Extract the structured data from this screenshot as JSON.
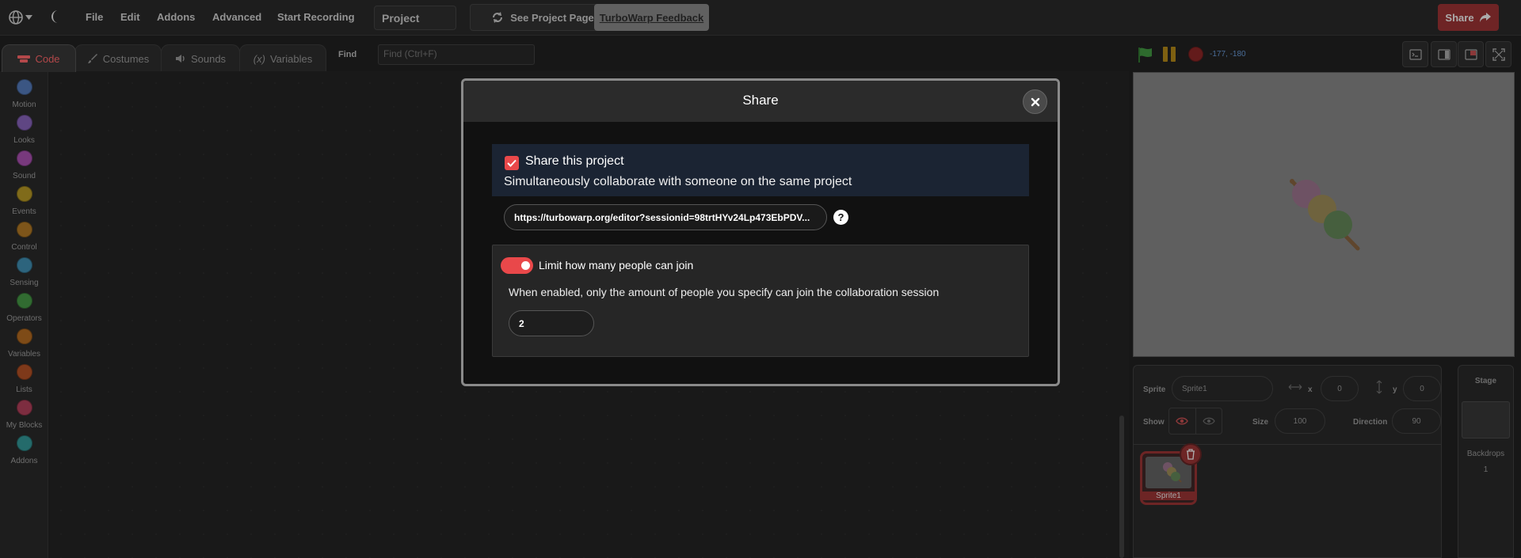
{
  "menubar": {
    "file": "File",
    "edit": "Edit",
    "addons": "Addons",
    "advanced": "Advanced",
    "start_recording": "Start Recording",
    "project_title": "Project",
    "see_project_page": "See Project Page",
    "feedback": "TurboWarp Feedback",
    "share": "Share"
  },
  "tabs": [
    {
      "label": "Code",
      "active": true
    },
    {
      "label": "Costumes"
    },
    {
      "label": "Sounds"
    },
    {
      "label": "Variables"
    }
  ],
  "find": {
    "label": "Find",
    "placeholder": "Find (Ctrl+F)"
  },
  "categories": [
    {
      "label": "Motion",
      "color": "#4c6fa8"
    },
    {
      "label": "Looks",
      "color": "#7a5aa8"
    },
    {
      "label": "Sound",
      "color": "#9a4aa0"
    },
    {
      "label": "Events",
      "color": "#a58a22"
    },
    {
      "label": "Control",
      "color": "#a06e22"
    },
    {
      "label": "Sensing",
      "color": "#3a80a0"
    },
    {
      "label": "Operators",
      "color": "#3f8a3f"
    },
    {
      "label": "Variables",
      "color": "#a2601e"
    },
    {
      "label": "Lists",
      "color": "#a24a22"
    },
    {
      "label": "My Blocks",
      "color": "#a03a52"
    },
    {
      "label": "Addons",
      "color": "#2f8a8a"
    }
  ],
  "stage": {
    "coords": "-177, -180"
  },
  "sprite_info": {
    "sprite_label": "Sprite",
    "sprite_name": "Sprite1",
    "x_label": "x",
    "x_value": "0",
    "y_label": "y",
    "y_value": "0",
    "show_label": "Show",
    "size_label": "Size",
    "size_value": "100",
    "direction_label": "Direction",
    "direction_value": "90",
    "selected_sprite": "Sprite1"
  },
  "stage_pane": {
    "title": "Stage",
    "backdrops_label": "Backdrops",
    "backdrops_count": "1"
  },
  "modal": {
    "title": "Share",
    "share_checkbox_label": "Share this project",
    "share_checkbox_checked": true,
    "share_description": "Simultaneously collaborate with someone on the same project",
    "url": "https://turbowarp.org/editor?sessionid=98trtHYv24Lp473EbPDV...",
    "limit_label": "Limit how many people can join",
    "limit_enabled": true,
    "limit_description": "When enabled, only the amount of people you specify can join the collaboration session",
    "limit_value": "2"
  },
  "colors": {
    "accent": "#e9484a",
    "share_button": "#8e2f30",
    "modal_highlight": "#1b2433"
  }
}
